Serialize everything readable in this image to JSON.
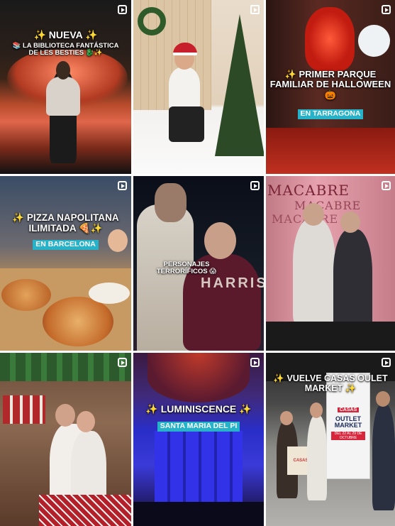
{
  "tiles": [
    {
      "title": "✨ NUEVA ✨",
      "subtitle": "📚 LA BIBLIOTECA FANTÁSTICA DE LES BESTIES 🐉✨"
    },
    {},
    {
      "title": "✨ PRIMER PARQUE FAMILIAR DE HALLOWEEN 🎃",
      "highlight": "EN TARRAGONA"
    },
    {
      "title": "✨ PIZZA NAPOLITANA ILIMITADA 🍕✨",
      "highlight": "EN BARCELONA"
    },
    {
      "title": "PERSONAJES TERRORÍFICOS 😱",
      "sweatshirt": "HARRIS"
    },
    {
      "banner": "MACABRE"
    },
    {},
    {
      "title": "✨ LUMINISCENCE ✨",
      "highlight": "SANTA MARIA DEL PI"
    },
    {
      "title": "✨ VUELVE CASAS OULET MARKET ✨",
      "poster_brand": "CASAS",
      "poster_title": "OUTLET MARKET",
      "poster_dates": "DEL 22 AL 29 DE OCTUBRE",
      "bag": "CASAS"
    }
  ]
}
